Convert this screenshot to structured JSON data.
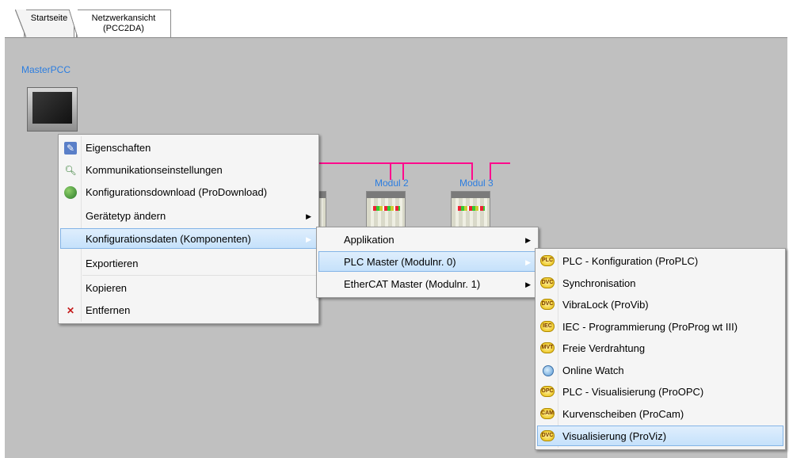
{
  "tabs": [
    {
      "label": "Startseite"
    },
    {
      "label": "Netzwerkansicht\n(PCC2DA)"
    }
  ],
  "canvas": {
    "node_label": "MasterPCC",
    "modules": [
      {
        "label": "Modul 2"
      },
      {
        "label": "Modul 3"
      }
    ],
    "bus_color": "#ff0a8c"
  },
  "context_menu": {
    "items": [
      {
        "label": "Eigenschaften",
        "icon": "properties-icon"
      },
      {
        "label": "Kommunikationseinstellungen",
        "icon": "search-icon"
      },
      {
        "label": "Konfigurationsdownload (ProDownload)",
        "icon": "globe-icon"
      },
      {
        "label": "Gerätetyp ändern",
        "submenu": true
      },
      {
        "label": "Konfigurationsdaten (Komponenten)",
        "submenu": true,
        "highlighted": true
      },
      {
        "label": "Exportieren"
      },
      {
        "label": "Kopieren"
      },
      {
        "label": "Entfernen",
        "icon": "close-icon"
      }
    ]
  },
  "submenu_1": {
    "items": [
      {
        "label": "Applikation",
        "submenu": true
      },
      {
        "label": "PLC Master (Modulnr. 0)",
        "submenu": true,
        "highlighted": true
      },
      {
        "label": "EtherCAT Master (Modulnr. 1)",
        "submenu": true
      }
    ]
  },
  "submenu_2": {
    "items": [
      {
        "label": "PLC - Konfiguration (ProPLC)",
        "badge": "PLC"
      },
      {
        "label": "Synchronisation",
        "badge": "DVC"
      },
      {
        "label": "VibraLock (ProVib)",
        "badge": "DVC"
      },
      {
        "label": "IEC - Programmierung (ProProg wt III)",
        "badge": "IEC"
      },
      {
        "label": "Freie Verdrahtung",
        "badge": "MVT"
      },
      {
        "label": "Online Watch",
        "badge": "watch"
      },
      {
        "label": "PLC - Visualisierung (ProOPC)",
        "badge": "OPC"
      },
      {
        "label": "Kurvenscheiben (ProCam)",
        "badge": "CAM"
      },
      {
        "label": "Visualisierung (ProViz)",
        "badge": "DVC",
        "highlighted": true
      }
    ]
  },
  "colors": {
    "highlight": "#c5e1fb",
    "highlight_border": "#84b4e6",
    "canvas": "#c0c0c0",
    "label_blue": "#2b7de0"
  }
}
